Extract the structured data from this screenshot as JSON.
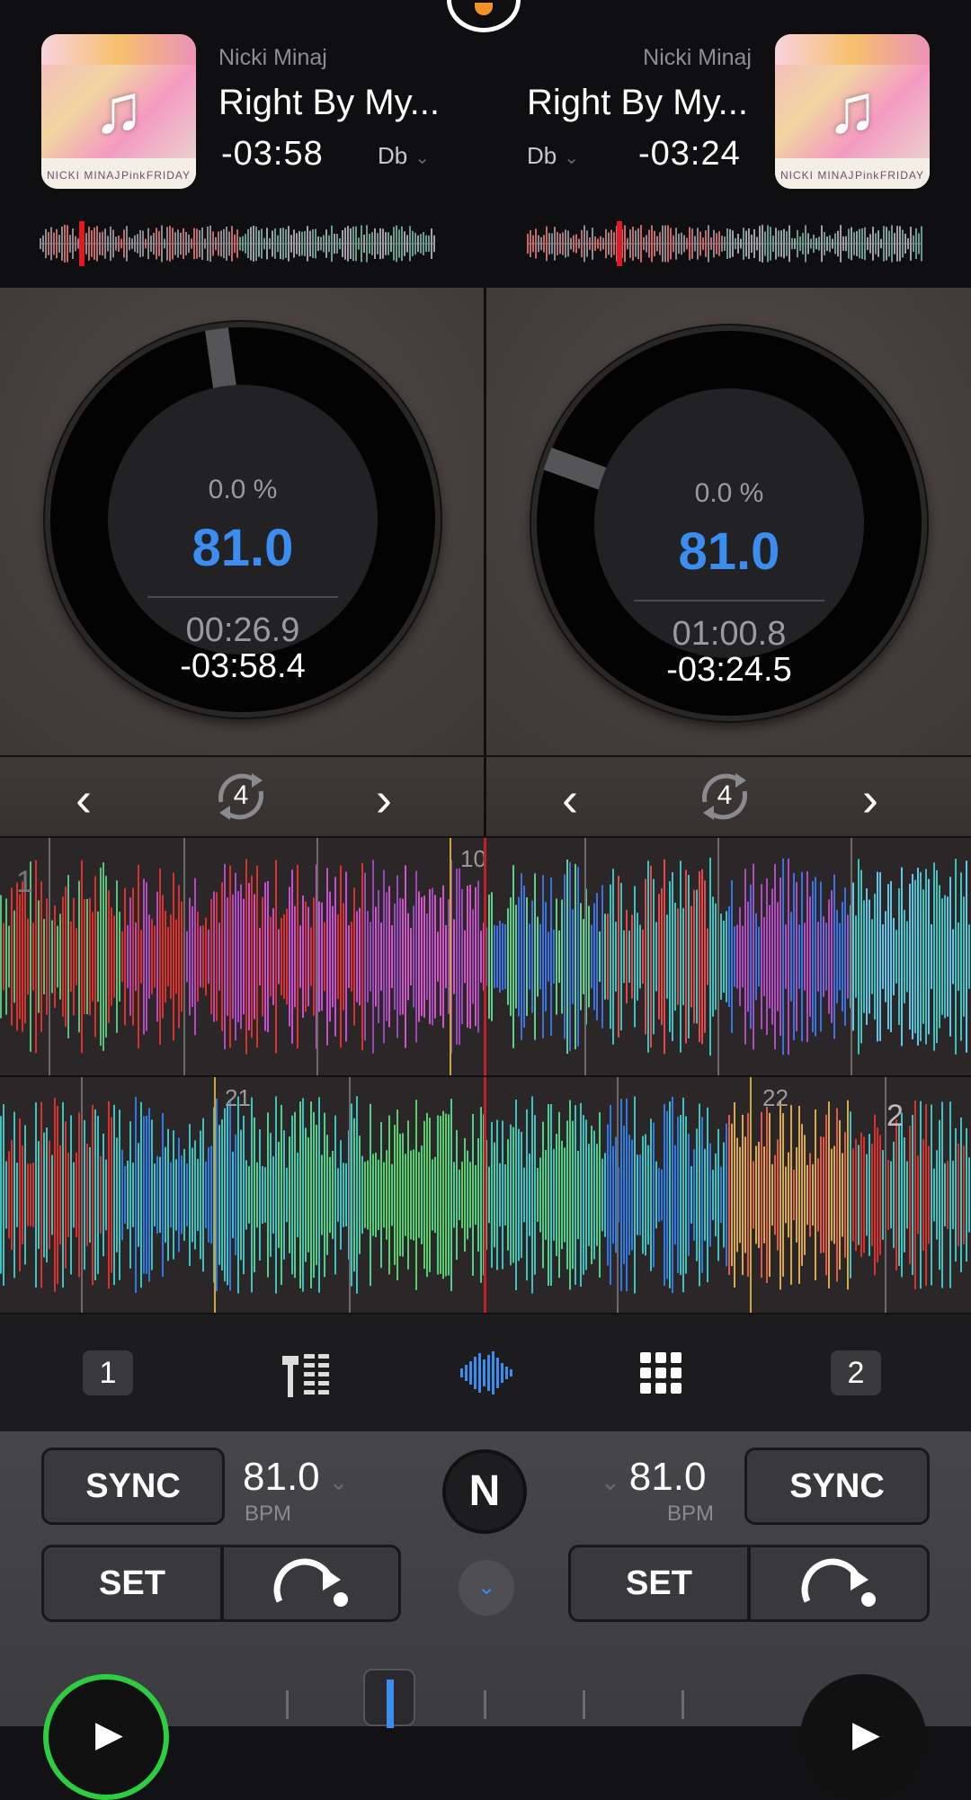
{
  "deck_left": {
    "artist": "Nicki Minaj",
    "title": "Right By My...",
    "remaining": "-03:58",
    "key": "Db",
    "pitch": "0.0 %",
    "bpm": "81.0",
    "elapsed": "00:26.9",
    "remaining_precise": "-03:58.4",
    "loop_size": "4",
    "sync_label": "SYNC",
    "set_label": "SET",
    "bpm_label": "BPM",
    "art_strip": [
      "NICKI MINAJ",
      "Pink",
      "FRIDAY"
    ]
  },
  "deck_right": {
    "artist": "Nicki Minaj",
    "title": "Right By My...",
    "remaining": "-03:24",
    "key": "Db",
    "pitch": "0.0 %",
    "bpm": "81.0",
    "elapsed": "01:00.8",
    "remaining_precise": "-03:24.5",
    "loop_size": "4",
    "sync_label": "SYNC",
    "set_label": "SET",
    "bpm_label": "BPM",
    "art_strip": [
      "NICKI MINAJ",
      "Pink",
      "FRIDAY"
    ]
  },
  "waveform_top": {
    "bar_label": "10",
    "deck_marker": "1"
  },
  "waveform_bottom": {
    "bar_label_a": "21",
    "bar_label_b": "22",
    "deck_marker": "2"
  },
  "tabs": {
    "deck1": "1",
    "deck2": "2"
  },
  "center": {
    "logo": "N"
  },
  "colors": {
    "accent": "#3b8ef0",
    "playhead": "#c41e28",
    "play_ring": "#2ecc40",
    "background": "#121214"
  },
  "icons": [
    "music-note-icon",
    "chevron-left-icon",
    "chevron-right-icon",
    "loop-icon",
    "mixer-icon",
    "waveform-icon",
    "grid-icon",
    "cue-icon",
    "chevron-down-icon",
    "play-icon"
  ]
}
